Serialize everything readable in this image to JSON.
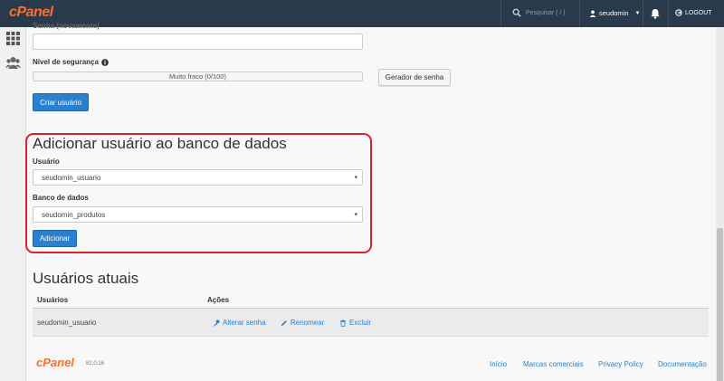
{
  "app": {
    "logo": "cPanel",
    "brand_color": "#ff6c2c",
    "accent": "#2a7fcf",
    "topbar_color": "#293a4a"
  },
  "topbar": {
    "search_placeholder": "Pesquisar ( / )",
    "username": "seudomin",
    "logout_label": "LOGOUT"
  },
  "sidebar": {
    "items": [
      {
        "icon": "grid-icon"
      },
      {
        "icon": "users-icon"
      }
    ]
  },
  "form": {
    "password_again_label": "Senha (novamente)",
    "security_level_label": "Nível de segurança",
    "security_meter_text": "Muito fraco (0/100)",
    "security_value": 0,
    "password_generator_label": "Gerador de senha",
    "create_user_button": "Criar usuário"
  },
  "add_user_section": {
    "title": "Adicionar usuário ao banco de dados",
    "user_label": "Usuário",
    "user_value": "seudomin_usuario",
    "database_label": "Banco de dados",
    "database_value": "seudomin_produtos",
    "add_button": "Adicionar"
  },
  "current_users": {
    "title": "Usuários atuais",
    "headers": [
      "Usuários",
      "Ações"
    ],
    "rows": [
      {
        "user": "seudomin_usuario",
        "actions": [
          "Alterar senha",
          "Renomear",
          "Excluir"
        ]
      }
    ]
  },
  "footer": {
    "logo": "cPanel",
    "version": "82.0.16",
    "links": [
      "Início",
      "Marcas comerciais",
      "Privacy Policy",
      "Documentação"
    ]
  }
}
